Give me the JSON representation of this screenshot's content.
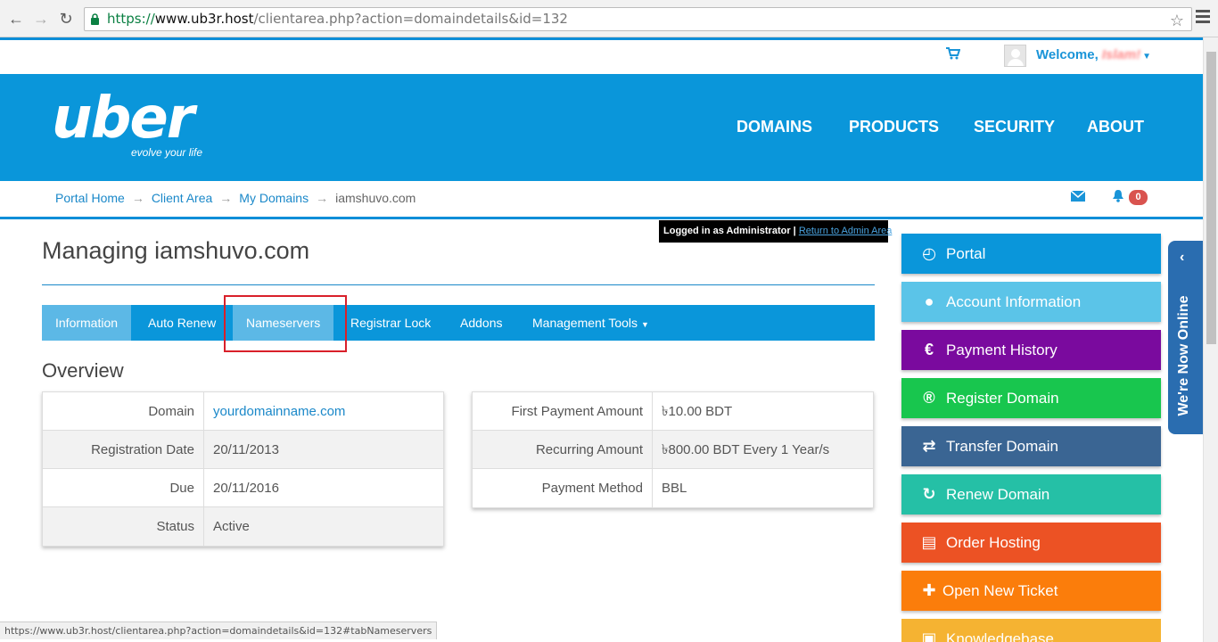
{
  "browser": {
    "url_scheme": "https://",
    "url_host": "www.ub3r.host",
    "url_path": "/clientarea.php?action=domaindetails&id=132",
    "status_url": "https://www.ub3r.host/clientarea.php?action=domaindetails&id=132#tabNameservers"
  },
  "topbar": {
    "welcome": "Welcome,",
    "username": "Islam!"
  },
  "brand": {
    "logo": "uber",
    "tagline": "evolve your life",
    "color": "#0a96da"
  },
  "nav": [
    "DOMAINS",
    "PRODUCTS",
    "SECURITY",
    "ABOUT"
  ],
  "breadcrumb": {
    "home": "Portal Home",
    "client": "Client Area",
    "domains": "My Domains",
    "current": "iamshuvo.com"
  },
  "notifications": {
    "count": "0"
  },
  "admin": {
    "text": "Logged in as Administrator",
    "sep": "|",
    "link": "Return to Admin Area"
  },
  "page": {
    "title": "Managing iamshuvo.com",
    "section": "Overview"
  },
  "tabs": [
    "Information",
    "Auto Renew",
    "Nameservers",
    "Registrar Lock",
    "Addons",
    "Management Tools"
  ],
  "overview_left": [
    {
      "k": "Domain",
      "v": "yourdomainname.com"
    },
    {
      "k": "Registration Date",
      "v": "20/11/2013"
    },
    {
      "k": "Due",
      "v": "20/11/2016"
    },
    {
      "k": "Status",
      "v": "Active"
    }
  ],
  "overview_right": [
    {
      "k": "First Payment Amount",
      "v": "৳10.00 BDT"
    },
    {
      "k": "Recurring Amount",
      "v": "৳800.00 BDT Every 1 Year/s"
    },
    {
      "k": "Payment Method",
      "v": "BBL"
    }
  ],
  "sidebar": [
    {
      "label": "Portal",
      "icon": "dashboard-icon",
      "color": "#0a96da"
    },
    {
      "label": "Account Information",
      "icon": "user-icon",
      "color": "#5bc4e8"
    },
    {
      "label": "Payment History",
      "icon": "euro-icon",
      "color": "#7a0a9e"
    },
    {
      "label": "Register Domain",
      "icon": "registered-icon",
      "color": "#18c64e"
    },
    {
      "label": "Transfer Domain",
      "icon": "exchange-icon",
      "color": "#3a6593"
    },
    {
      "label": "Renew Domain",
      "icon": "refresh-icon",
      "color": "#25c0a6"
    },
    {
      "label": "Order Hosting",
      "icon": "hdd-icon",
      "color": "#ec5224"
    },
    {
      "label": "Open New Ticket",
      "icon": "plus-icon",
      "color": "#fb7d0b"
    },
    {
      "label": "Knowledgebase",
      "icon": "book-icon",
      "color": "#f5b332"
    }
  ],
  "chat": {
    "label": "We're Now Online"
  }
}
